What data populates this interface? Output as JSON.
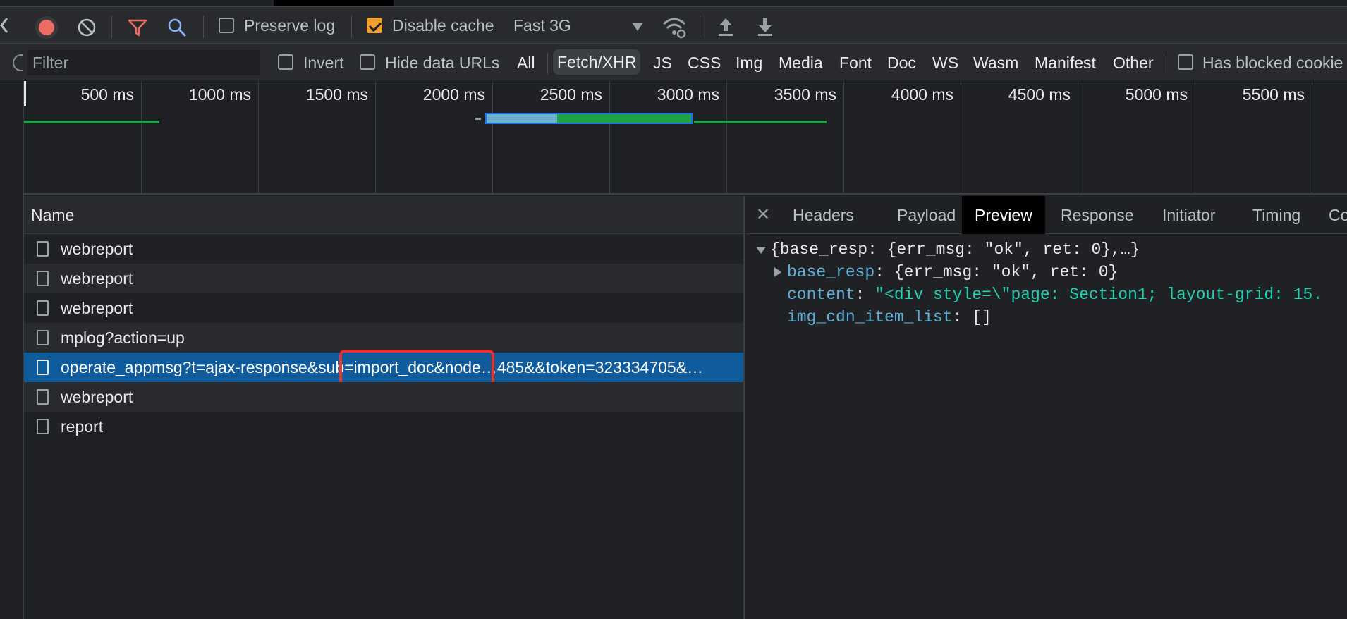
{
  "toolbar": {
    "preserve_log_label": "Preserve log",
    "preserve_log_checked": false,
    "disable_cache_label": "Disable cache",
    "disable_cache_checked": true,
    "throttling_value": "Fast 3G",
    "icons": [
      "chevron-left-icon",
      "record-icon",
      "clear-icon",
      "filter-icon",
      "search-icon",
      "network-conditions-icon",
      "import-har-icon",
      "export-har-icon"
    ],
    "record_color": "#ee6b65"
  },
  "filterbar": {
    "placeholder": "Filter",
    "invert_label": "Invert",
    "hide_data_urls_label": "Hide data URLs",
    "types": [
      "All",
      "Fetch/XHR",
      "JS",
      "CSS",
      "Img",
      "Media",
      "Font",
      "Doc",
      "WS",
      "Wasm",
      "Manifest",
      "Other"
    ],
    "active_type": "Fetch/XHR",
    "has_blocked_label": "Has blocked cookie"
  },
  "timeline": {
    "ticks": [
      "500 ms",
      "1000 ms",
      "1500 ms",
      "2000 ms",
      "2500 ms",
      "3000 ms",
      "3500 ms",
      "4000 ms",
      "4500 ms",
      "5000 ms",
      "5500 ms"
    ]
  },
  "requests": {
    "header": "Name",
    "rows": [
      {
        "name": "webreport",
        "selected": false
      },
      {
        "name": "webreport",
        "selected": false
      },
      {
        "name": "webreport",
        "selected": false
      },
      {
        "name": "mplog?action=up",
        "selected": false
      },
      {
        "name": "operate_appmsg?t=ajax-response&sub=import_doc&node…485&&token=323334705&…",
        "selected": true
      },
      {
        "name": "webreport",
        "selected": false
      },
      {
        "name": "report",
        "selected": false
      }
    ],
    "highlight_color": "#e8322b"
  },
  "detail": {
    "tabs": [
      "Headers",
      "Payload",
      "Preview",
      "Response",
      "Initiator",
      "Timing",
      "Co"
    ],
    "active_tab": "Preview",
    "preview": {
      "summary": "{base_resp: {err_msg: \"ok\", ret: 0},…}",
      "base_resp_key": "base_resp",
      "base_resp_value": "{err_msg: \"ok\", ret: 0}",
      "content_key": "content",
      "content_value": "\"<div style=\\\"page: Section1; layout-grid: 15.",
      "img_key": "img_cdn_item_list",
      "img_value": "[]"
    }
  },
  "colors": {
    "panel_bg": "#202124",
    "selected_row": "#0f5b9c",
    "waterfall_green": "#1ea446",
    "json_key": "#5db0d7",
    "json_string": "#1fd1b0"
  }
}
